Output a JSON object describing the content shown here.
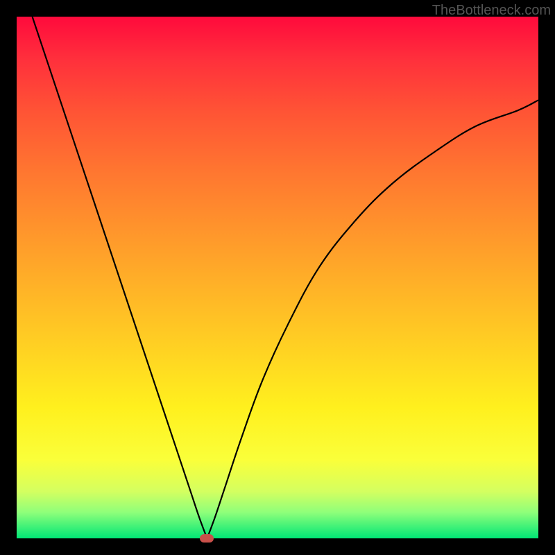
{
  "watermark": "TheBottleneck.com",
  "chart_data": {
    "type": "line",
    "title": "",
    "xlabel": "",
    "ylabel": "",
    "xlim": [
      0,
      100
    ],
    "ylim": [
      0,
      100
    ],
    "series": [
      {
        "name": "left-branch",
        "x": [
          3,
          6,
          10,
          14,
          18,
          22,
          26,
          30,
          33,
          35,
          36.5
        ],
        "values": [
          100,
          91,
          79,
          67,
          55,
          43,
          31,
          19,
          10,
          4,
          0
        ]
      },
      {
        "name": "right-branch",
        "x": [
          36.5,
          38,
          40,
          43,
          47,
          52,
          58,
          65,
          72,
          80,
          88,
          96,
          100
        ],
        "values": [
          0,
          4,
          10,
          19,
          30,
          41,
          52,
          61,
          68,
          74,
          79,
          82,
          84
        ]
      }
    ],
    "marker": {
      "x": 36.5,
      "y": 0
    },
    "background_gradient": {
      "top": "#ff0a3c",
      "mid": "#ffc824",
      "bottom": "#00e676"
    }
  }
}
